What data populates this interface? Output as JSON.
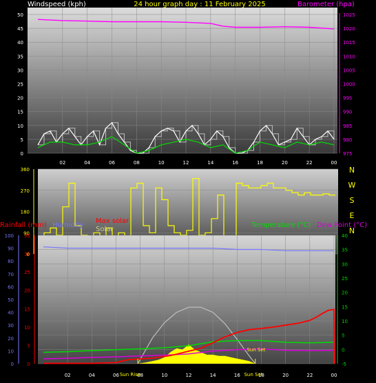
{
  "header": {
    "left_title": "Windspeed (kph)",
    "center_title": "24 hour graph day : 11 February 2025",
    "right_title": "Barometer (hpa)"
  },
  "colors": {
    "windspeed": "#ffffff",
    "gust": "#c0c0c0",
    "wind_avg": "#00dd00",
    "barometer": "#ff00ff",
    "direction": "#ffff00",
    "rainfall": "#ff0000",
    "humidity": "#7777ff",
    "max_solar": "#c0c0c0",
    "solar": "#ffff00",
    "temperature": "#00dd00",
    "dew_point": "#dd00dd",
    "sun_markers": "#ffff00"
  },
  "time_ticks": [
    "02",
    "04",
    "06",
    "08",
    "10",
    "12",
    "14",
    "16",
    "18",
    "20",
    "22",
    "00"
  ],
  "chart_data": [
    {
      "type": "line",
      "panel": "wind-barometer",
      "y_left": {
        "ticks": [
          "0",
          "5",
          "10",
          "15",
          "20",
          "25",
          "30",
          "35",
          "40",
          "45",
          "50"
        ],
        "range": [
          0,
          50
        ]
      },
      "y_right": {
        "ticks": [
          "975",
          "980",
          "985",
          "990",
          "995",
          "1000",
          "1005",
          "1010",
          "1015",
          "1020",
          "1025"
        ],
        "range": [
          975,
          1025
        ]
      },
      "grid": true,
      "series": [
        {
          "name": "Barometer (hpa)",
          "axis": "right",
          "x": [
            0,
            2,
            4,
            6,
            8,
            10,
            12,
            14,
            15,
            16,
            18,
            20,
            22,
            24
          ],
          "values": [
            1023.2,
            1022.8,
            1022.6,
            1022.4,
            1022.4,
            1022.4,
            1022.2,
            1021.8,
            1020.8,
            1020.4,
            1020.4,
            1020.6,
            1020.4,
            1019.8
          ]
        },
        {
          "name": "Windspeed (kph)",
          "axis": "left",
          "x": [
            0,
            0.5,
            1,
            1.5,
            2,
            2.5,
            3,
            3.5,
            4,
            4.5,
            5,
            5.5,
            6,
            6.5,
            7,
            7.5,
            8,
            8.5,
            9,
            9.5,
            10,
            10.5,
            11,
            11.5,
            12,
            12.5,
            13,
            13.5,
            14,
            14.5,
            15,
            15.5,
            16,
            16.5,
            17,
            17.5,
            18,
            18.5,
            19,
            19.5,
            20,
            20.5,
            21,
            21.5,
            22,
            22.5,
            23,
            23.5,
            24
          ],
          "values": [
            3,
            7,
            8,
            4,
            7,
            9,
            6,
            3,
            6,
            8,
            3,
            9,
            11,
            7,
            4,
            1,
            0,
            0,
            2,
            6,
            8,
            9,
            8,
            4,
            8,
            10,
            7,
            3,
            5,
            8,
            6,
            2,
            0,
            0,
            1,
            4,
            8,
            10,
            7,
            3,
            4,
            5,
            9,
            6,
            3,
            5,
            6,
            8,
            5
          ]
        },
        {
          "name": "Average speed",
          "axis": "left",
          "x": [
            0,
            1,
            2,
            3,
            4,
            5,
            6,
            7,
            8,
            9,
            10,
            11,
            12,
            13,
            14,
            15,
            16,
            17,
            18,
            19,
            20,
            21,
            22,
            23,
            24
          ],
          "values": [
            2,
            4,
            4,
            3,
            3,
            4,
            6,
            3,
            0,
            1,
            3,
            4,
            5,
            4,
            2,
            3,
            0,
            1,
            4,
            3,
            2,
            4,
            3,
            4,
            3
          ]
        }
      ]
    },
    {
      "type": "line",
      "panel": "wind-direction",
      "y_left": {
        "ticks": [
          "360",
          "270",
          "180",
          "90",
          "0"
        ],
        "range": [
          0,
          360
        ]
      },
      "compass": [
        "N",
        "W",
        "S",
        "E",
        "N"
      ],
      "series": [
        {
          "name": "Wind direction",
          "axis": "left",
          "x": [
            0,
            0.5,
            1,
            1.5,
            2,
            2.5,
            3,
            3.5,
            4,
            4.5,
            5,
            5.5,
            6,
            6.5,
            7,
            7.5,
            8,
            8.5,
            9,
            9.5,
            10,
            10.5,
            11,
            11.5,
            12,
            12.5,
            13,
            13.5,
            14,
            14.5,
            15,
            15.5,
            16,
            16.5,
            17,
            17.5,
            18,
            18.5,
            19,
            19.5,
            20,
            20.5,
            21,
            21.5,
            22,
            22.5,
            23,
            23.5,
            24
          ],
          "values": [
            60,
            90,
            110,
            80,
            200,
            300,
            120,
            80,
            70,
            90,
            60,
            110,
            70,
            90,
            60,
            280,
            300,
            120,
            90,
            280,
            230,
            120,
            90,
            80,
            100,
            320,
            80,
            90,
            150,
            250,
            60,
            0,
            300,
            290,
            280,
            280,
            290,
            300,
            280,
            280,
            270,
            260,
            250,
            260,
            250,
            250,
            255,
            250,
            250
          ]
        }
      ]
    },
    {
      "type": "line",
      "panel": "temperature-rain-solar",
      "legend": [
        "Rainfall (mm)",
        "Humidity",
        "Max solar",
        "Solar",
        "Temperature (°C)",
        "Dew Point (°C)"
      ],
      "axis_humidity": {
        "ticks": [
          "0",
          "10",
          "20",
          "30",
          "40",
          "50",
          "60",
          "70",
          "80",
          "90",
          "100"
        ],
        "range": [
          0,
          100
        ]
      },
      "axis_rainfall": {
        "ticks": [
          "0",
          "5",
          "10",
          "15",
          "20",
          "25",
          "30",
          "35"
        ],
        "range": [
          0,
          35
        ]
      },
      "axis_temperature": {
        "ticks": [
          "-5",
          "0",
          "5",
          "10",
          "15",
          "20",
          "25",
          "30",
          "35",
          "40"
        ],
        "range": [
          -5,
          40
        ]
      },
      "annotations": [
        "Sun Rise",
        "Sun Set",
        "Sun Set"
      ],
      "series": [
        {
          "name": "Humidity",
          "axis": "humidity",
          "x": [
            0,
            2,
            4,
            6,
            8,
            10,
            12,
            14,
            16,
            18,
            20,
            22,
            24
          ],
          "values": [
            91,
            90,
            90,
            90,
            90,
            90,
            90,
            90,
            89,
            89,
            88,
            88,
            88
          ]
        },
        {
          "name": "Rainfall (mm)",
          "axis": "rainfall",
          "x": [
            0,
            4,
            6,
            7,
            9,
            10.5,
            12,
            13,
            14,
            15,
            16,
            17,
            18,
            19,
            20,
            21,
            22,
            22.5,
            23,
            23.5,
            24,
            24.05
          ],
          "values": [
            0.1,
            0.1,
            0.3,
            1.1,
            1.5,
            2.2,
            3.4,
            4.2,
            5.7,
            7.3,
            8.5,
            9.3,
            9.6,
            10,
            10.5,
            11,
            11.8,
            12.6,
            13.6,
            14.5,
            14.8,
            0
          ]
        },
        {
          "name": "Temperature (°C)",
          "axis": "temperature",
          "x": [
            0,
            2,
            4,
            6,
            8,
            10,
            12,
            14,
            16,
            18,
            20,
            22,
            24
          ],
          "values": [
            -1,
            -0.8,
            -0.4,
            -0.1,
            0.2,
            0.6,
            1.3,
            2.7,
            3.1,
            3.1,
            2.5,
            2.3,
            2.5
          ]
        },
        {
          "name": "Dew Point (°C)",
          "axis": "temperature",
          "x": [
            0,
            2,
            4,
            6,
            8,
            10,
            12,
            14,
            16,
            18,
            20,
            22,
            24
          ],
          "values": [
            -3.3,
            -3.1,
            -2.8,
            -2.6,
            -2.3,
            -2.0,
            -1.6,
            -0.6,
            -0.1,
            0.2,
            -0.3,
            -0.4,
            -0.3
          ]
        },
        {
          "name": "Max solar",
          "axis": "humidity",
          "x": [
            7.8,
            9,
            10,
            11,
            12,
            13,
            14,
            15,
            16,
            17,
            17.5
          ],
          "values": [
            0,
            20,
            32,
            40,
            44,
            44,
            40,
            31,
            19,
            6,
            0
          ]
        },
        {
          "name": "Solar",
          "axis": "humidity",
          "x": [
            7.8,
            8.5,
            9,
            9.5,
            10,
            10.5,
            11,
            11.5,
            12,
            12.5,
            13,
            13.5,
            14,
            14.5,
            15,
            15.5,
            16,
            16.5,
            17,
            17.5
          ],
          "values": [
            0,
            1,
            2,
            3,
            5,
            9,
            12,
            11,
            15,
            11,
            9,
            7,
            7,
            6,
            6,
            5,
            4,
            3,
            2,
            0
          ]
        }
      ]
    }
  ]
}
